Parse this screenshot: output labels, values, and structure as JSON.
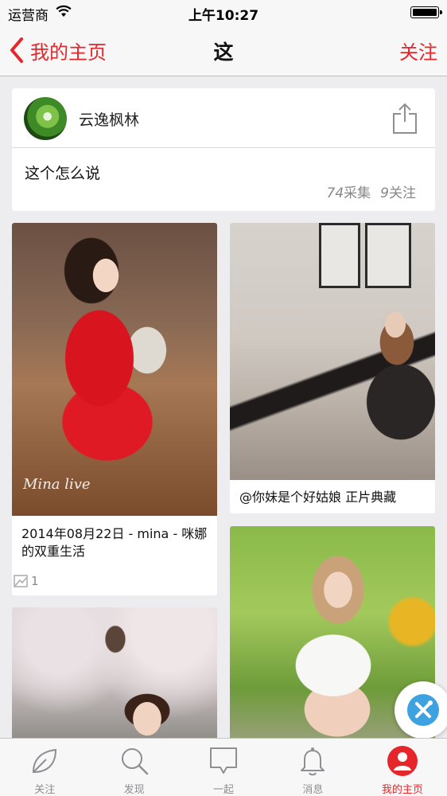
{
  "status_bar": {
    "carrier": "运营商",
    "time": "上午10:27"
  },
  "nav": {
    "back_label": "我的主页",
    "title": "这",
    "follow_label": "关注"
  },
  "board": {
    "author": "云逸枫林",
    "description": "这个怎么说",
    "pins_count": "74",
    "pins_label": "采集",
    "followers_count": "9",
    "followers_label": "关注"
  },
  "pins": [
    {
      "caption": "2014年08月22日 - mina - 咪娜的双重生活",
      "watermark": "Mina live",
      "repin_count": "1"
    },
    {
      "caption": "@你妹是个好姑娘 正片典藏"
    },
    {
      "caption": ""
    },
    {
      "caption": ""
    }
  ],
  "tabs": [
    {
      "label": "关注",
      "icon": "leaf-icon"
    },
    {
      "label": "发现",
      "icon": "search-icon"
    },
    {
      "label": "一起",
      "icon": "chat-bubble-icon"
    },
    {
      "label": "消息",
      "icon": "bell-icon"
    },
    {
      "label": "我的主页",
      "icon": "profile-icon",
      "active": true
    }
  ],
  "colors": {
    "accent": "#e5262b",
    "fab": "#3ea2e0",
    "background": "#ededf0"
  }
}
